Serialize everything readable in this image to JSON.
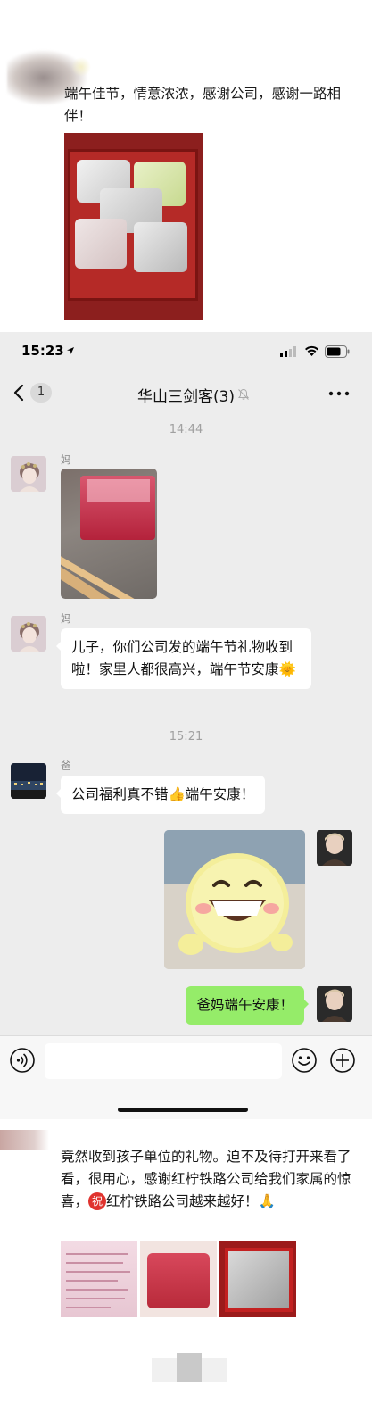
{
  "moment_top": {
    "text": "端午佳节，情意浓浓，感谢公司，感谢一路相伴！"
  },
  "status_bar": {
    "time": "15:23"
  },
  "chat": {
    "unread_count": "1",
    "title": "华山三剑客(3)",
    "timestamp_1": "14:44",
    "timestamp_2": "15:21",
    "messages": [
      {
        "sender": "妈",
        "type": "image"
      },
      {
        "sender": "妈",
        "type": "text",
        "text": "儿子，你们公司发的端午节礼物收到啦！家里人都很高兴，端午节安康🌞"
      },
      {
        "sender": "爸",
        "type": "text",
        "text": "公司福利真不错👍端午安康！"
      },
      {
        "sender": "me",
        "type": "sticker"
      },
      {
        "sender": "me",
        "type": "text",
        "text": "爸妈端午安康！"
      }
    ],
    "input_placeholder": ""
  },
  "moment_bottom": {
    "text_part1": "竟然收到孩子单位的礼物。迫不及待打开来看了看，很用心，感谢红柠铁路公司给我们家属的惊喜，",
    "badge": "祝",
    "text_part2": "红柠铁路公司越来越好！🙏"
  },
  "colors": {
    "chat_background": "#ededed",
    "sent_bubble": "#95ec69",
    "received_bubble": "#ffffff",
    "timestamp": "#a0a0a0"
  }
}
